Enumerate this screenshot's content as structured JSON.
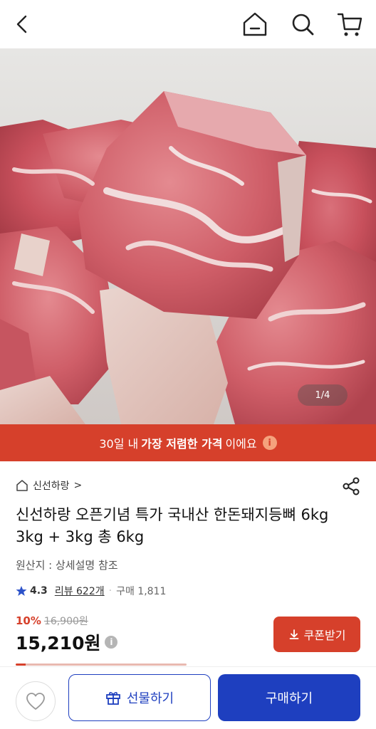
{
  "header": {
    "back_icon": "chevron-left-icon",
    "home_icon": "home-icon",
    "search_icon": "search-icon",
    "cart_icon": "cart-icon"
  },
  "hero": {
    "image_counter": "1/4"
  },
  "banner": {
    "prefix": "30일 내",
    "highlight": "가장 저렴한 가격",
    "suffix": "이에요",
    "info_glyph": "i",
    "color": "#d6402b"
  },
  "product": {
    "store_name": "신선하랑",
    "store_chevron": ">",
    "title": "신선하랑 오픈기념 특가 국내산 한돈돼지등뼈 6kg 3kg + 3kg 총 6kg",
    "origin": "원산지 : 상세설명 참조",
    "rating": "4.3",
    "reviews": "리뷰 622개",
    "separator": "·",
    "purchases": "구매 1,811",
    "discount_rate": "10%",
    "original_price": "16,900원",
    "sale_price": "15,210원",
    "price_info_glyph": "i"
  },
  "actions": {
    "coupon_label": "쿠폰받기",
    "gift_label": "선물하기",
    "buy_label": "구매하기",
    "primary_color": "#1e3fbf",
    "accent_color": "#d6402b"
  }
}
